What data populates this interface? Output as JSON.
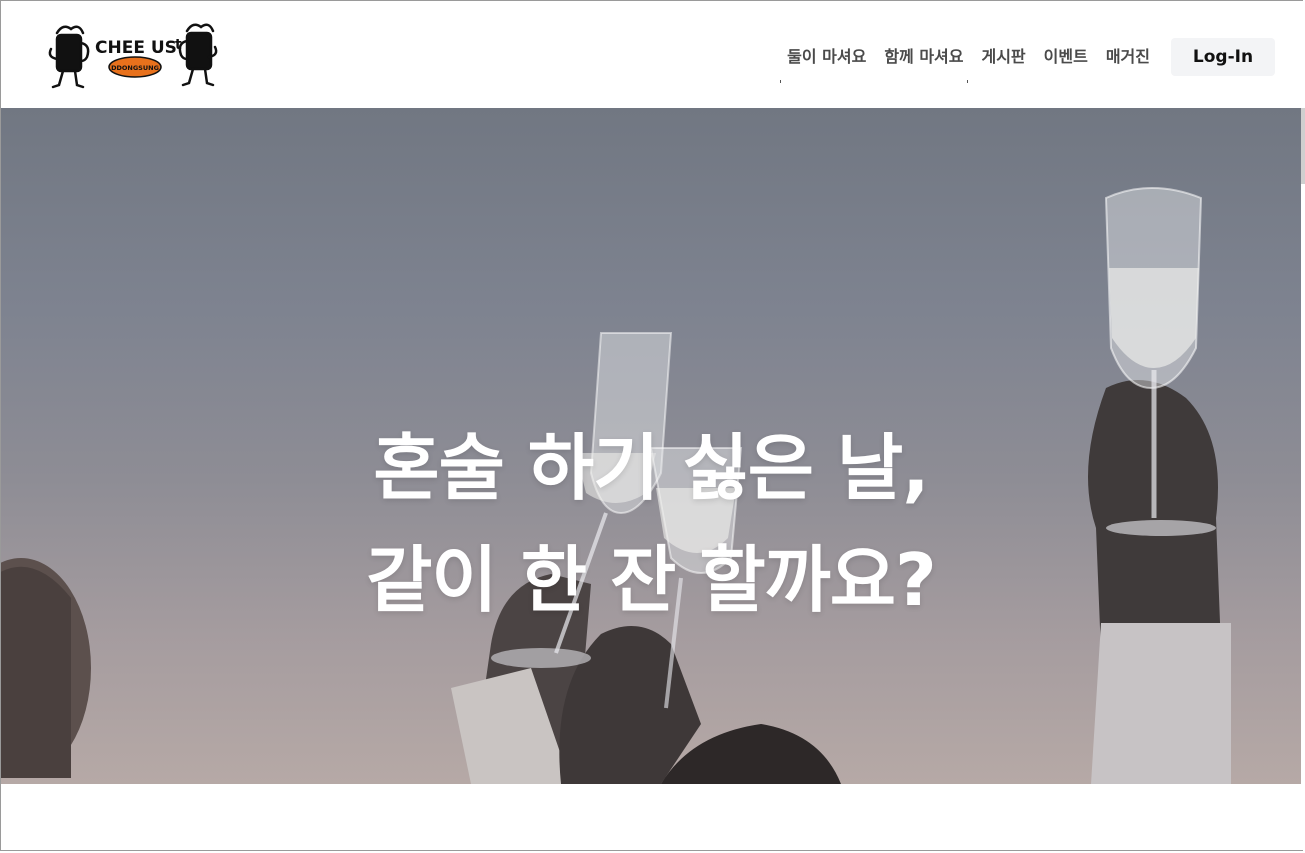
{
  "brand": {
    "logo_text": "CHEE US",
    "logo_subtext": "DDONGSUNG",
    "logo_color": "#e8711c"
  },
  "nav": {
    "items": [
      {
        "label": "둘이 마셔요"
      },
      {
        "label": "함께 마셔요"
      },
      {
        "label": "게시판"
      },
      {
        "label": "이벤트"
      },
      {
        "label": "매거진"
      }
    ],
    "login_label": "Log-In"
  },
  "hero": {
    "line1": "혼술 하기 싫은 날,",
    "line2": "같이 한 잔 할까요?"
  }
}
